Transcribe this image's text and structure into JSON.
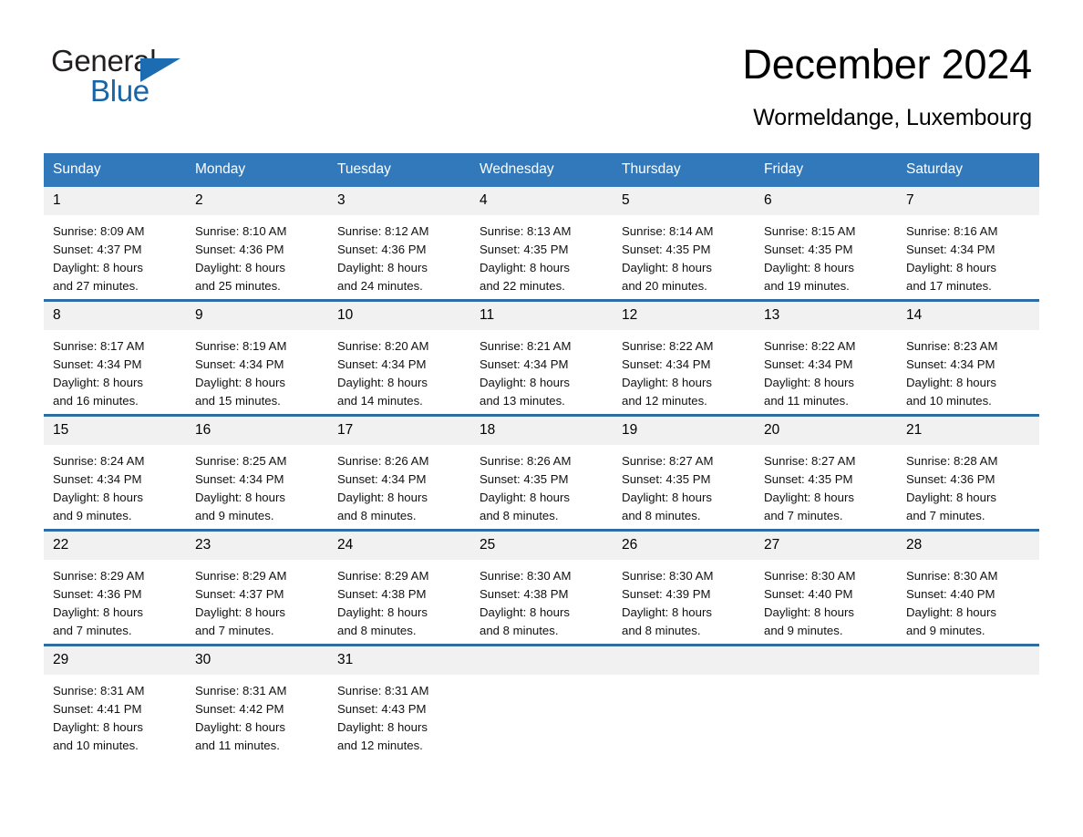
{
  "brand": {
    "name_part1": "General",
    "name_part2": "Blue",
    "triangle_color": "#1b6cb0",
    "part1_color": "#231f20",
    "part2_color": "#1565a8"
  },
  "header": {
    "title": "December 2024",
    "subtitle": "Wormeldange, Luxembourg"
  },
  "theme": {
    "header_bg": "#3279bb",
    "row_divider": "#2e6ca4",
    "daynum_bg": "#f1f1f1",
    "text": "#000000"
  },
  "calendar": {
    "weekday_headers": [
      "Sunday",
      "Monday",
      "Tuesday",
      "Wednesday",
      "Thursday",
      "Friday",
      "Saturday"
    ],
    "weeks": [
      [
        {
          "day": "1",
          "sunrise": "Sunrise: 8:09 AM",
          "sunset": "Sunset: 4:37 PM",
          "daylight_line1": "Daylight: 8 hours",
          "daylight_line2": "and 27 minutes."
        },
        {
          "day": "2",
          "sunrise": "Sunrise: 8:10 AM",
          "sunset": "Sunset: 4:36 PM",
          "daylight_line1": "Daylight: 8 hours",
          "daylight_line2": "and 25 minutes."
        },
        {
          "day": "3",
          "sunrise": "Sunrise: 8:12 AM",
          "sunset": "Sunset: 4:36 PM",
          "daylight_line1": "Daylight: 8 hours",
          "daylight_line2": "and 24 minutes."
        },
        {
          "day": "4",
          "sunrise": "Sunrise: 8:13 AM",
          "sunset": "Sunset: 4:35 PM",
          "daylight_line1": "Daylight: 8 hours",
          "daylight_line2": "and 22 minutes."
        },
        {
          "day": "5",
          "sunrise": "Sunrise: 8:14 AM",
          "sunset": "Sunset: 4:35 PM",
          "daylight_line1": "Daylight: 8 hours",
          "daylight_line2": "and 20 minutes."
        },
        {
          "day": "6",
          "sunrise": "Sunrise: 8:15 AM",
          "sunset": "Sunset: 4:35 PM",
          "daylight_line1": "Daylight: 8 hours",
          "daylight_line2": "and 19 minutes."
        },
        {
          "day": "7",
          "sunrise": "Sunrise: 8:16 AM",
          "sunset": "Sunset: 4:34 PM",
          "daylight_line1": "Daylight: 8 hours",
          "daylight_line2": "and 17 minutes."
        }
      ],
      [
        {
          "day": "8",
          "sunrise": "Sunrise: 8:17 AM",
          "sunset": "Sunset: 4:34 PM",
          "daylight_line1": "Daylight: 8 hours",
          "daylight_line2": "and 16 minutes."
        },
        {
          "day": "9",
          "sunrise": "Sunrise: 8:19 AM",
          "sunset": "Sunset: 4:34 PM",
          "daylight_line1": "Daylight: 8 hours",
          "daylight_line2": "and 15 minutes."
        },
        {
          "day": "10",
          "sunrise": "Sunrise: 8:20 AM",
          "sunset": "Sunset: 4:34 PM",
          "daylight_line1": "Daylight: 8 hours",
          "daylight_line2": "and 14 minutes."
        },
        {
          "day": "11",
          "sunrise": "Sunrise: 8:21 AM",
          "sunset": "Sunset: 4:34 PM",
          "daylight_line1": "Daylight: 8 hours",
          "daylight_line2": "and 13 minutes."
        },
        {
          "day": "12",
          "sunrise": "Sunrise: 8:22 AM",
          "sunset": "Sunset: 4:34 PM",
          "daylight_line1": "Daylight: 8 hours",
          "daylight_line2": "and 12 minutes."
        },
        {
          "day": "13",
          "sunrise": "Sunrise: 8:22 AM",
          "sunset": "Sunset: 4:34 PM",
          "daylight_line1": "Daylight: 8 hours",
          "daylight_line2": "and 11 minutes."
        },
        {
          "day": "14",
          "sunrise": "Sunrise: 8:23 AM",
          "sunset": "Sunset: 4:34 PM",
          "daylight_line1": "Daylight: 8 hours",
          "daylight_line2": "and 10 minutes."
        }
      ],
      [
        {
          "day": "15",
          "sunrise": "Sunrise: 8:24 AM",
          "sunset": "Sunset: 4:34 PM",
          "daylight_line1": "Daylight: 8 hours",
          "daylight_line2": "and 9 minutes."
        },
        {
          "day": "16",
          "sunrise": "Sunrise: 8:25 AM",
          "sunset": "Sunset: 4:34 PM",
          "daylight_line1": "Daylight: 8 hours",
          "daylight_line2": "and 9 minutes."
        },
        {
          "day": "17",
          "sunrise": "Sunrise: 8:26 AM",
          "sunset": "Sunset: 4:34 PM",
          "daylight_line1": "Daylight: 8 hours",
          "daylight_line2": "and 8 minutes."
        },
        {
          "day": "18",
          "sunrise": "Sunrise: 8:26 AM",
          "sunset": "Sunset: 4:35 PM",
          "daylight_line1": "Daylight: 8 hours",
          "daylight_line2": "and 8 minutes."
        },
        {
          "day": "19",
          "sunrise": "Sunrise: 8:27 AM",
          "sunset": "Sunset: 4:35 PM",
          "daylight_line1": "Daylight: 8 hours",
          "daylight_line2": "and 8 minutes."
        },
        {
          "day": "20",
          "sunrise": "Sunrise: 8:27 AM",
          "sunset": "Sunset: 4:35 PM",
          "daylight_line1": "Daylight: 8 hours",
          "daylight_line2": "and 7 minutes."
        },
        {
          "day": "21",
          "sunrise": "Sunrise: 8:28 AM",
          "sunset": "Sunset: 4:36 PM",
          "daylight_line1": "Daylight: 8 hours",
          "daylight_line2": "and 7 minutes."
        }
      ],
      [
        {
          "day": "22",
          "sunrise": "Sunrise: 8:29 AM",
          "sunset": "Sunset: 4:36 PM",
          "daylight_line1": "Daylight: 8 hours",
          "daylight_line2": "and 7 minutes."
        },
        {
          "day": "23",
          "sunrise": "Sunrise: 8:29 AM",
          "sunset": "Sunset: 4:37 PM",
          "daylight_line1": "Daylight: 8 hours",
          "daylight_line2": "and 7 minutes."
        },
        {
          "day": "24",
          "sunrise": "Sunrise: 8:29 AM",
          "sunset": "Sunset: 4:38 PM",
          "daylight_line1": "Daylight: 8 hours",
          "daylight_line2": "and 8 minutes."
        },
        {
          "day": "25",
          "sunrise": "Sunrise: 8:30 AM",
          "sunset": "Sunset: 4:38 PM",
          "daylight_line1": "Daylight: 8 hours",
          "daylight_line2": "and 8 minutes."
        },
        {
          "day": "26",
          "sunrise": "Sunrise: 8:30 AM",
          "sunset": "Sunset: 4:39 PM",
          "daylight_line1": "Daylight: 8 hours",
          "daylight_line2": "and 8 minutes."
        },
        {
          "day": "27",
          "sunrise": "Sunrise: 8:30 AM",
          "sunset": "Sunset: 4:40 PM",
          "daylight_line1": "Daylight: 8 hours",
          "daylight_line2": "and 9 minutes."
        },
        {
          "day": "28",
          "sunrise": "Sunrise: 8:30 AM",
          "sunset": "Sunset: 4:40 PM",
          "daylight_line1": "Daylight: 8 hours",
          "daylight_line2": "and 9 minutes."
        }
      ],
      [
        {
          "day": "29",
          "sunrise": "Sunrise: 8:31 AM",
          "sunset": "Sunset: 4:41 PM",
          "daylight_line1": "Daylight: 8 hours",
          "daylight_line2": "and 10 minutes."
        },
        {
          "day": "30",
          "sunrise": "Sunrise: 8:31 AM",
          "sunset": "Sunset: 4:42 PM",
          "daylight_line1": "Daylight: 8 hours",
          "daylight_line2": "and 11 minutes."
        },
        {
          "day": "31",
          "sunrise": "Sunrise: 8:31 AM",
          "sunset": "Sunset: 4:43 PM",
          "daylight_line1": "Daylight: 8 hours",
          "daylight_line2": "and 12 minutes."
        },
        {
          "day": "",
          "sunrise": "",
          "sunset": "",
          "daylight_line1": "",
          "daylight_line2": ""
        },
        {
          "day": "",
          "sunrise": "",
          "sunset": "",
          "daylight_line1": "",
          "daylight_line2": ""
        },
        {
          "day": "",
          "sunrise": "",
          "sunset": "",
          "daylight_line1": "",
          "daylight_line2": ""
        },
        {
          "day": "",
          "sunrise": "",
          "sunset": "",
          "daylight_line1": "",
          "daylight_line2": ""
        }
      ]
    ]
  }
}
